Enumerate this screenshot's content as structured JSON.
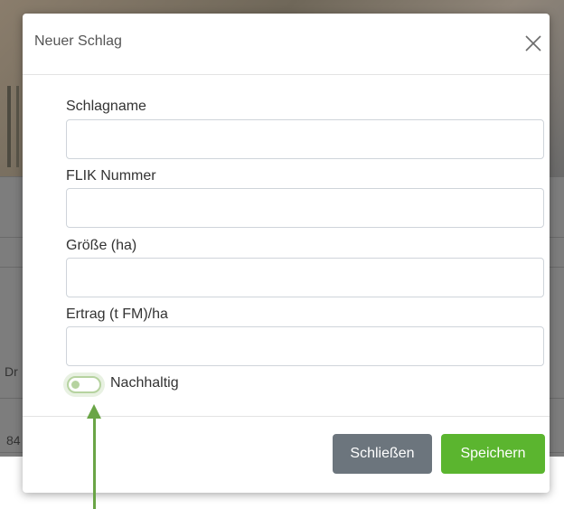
{
  "modal": {
    "title": "Neuer Schlag",
    "fields": [
      {
        "label": "Schlagname",
        "value": "",
        "placeholder": ""
      },
      {
        "label": "FLIK Nummer",
        "value": "",
        "placeholder": ""
      },
      {
        "label": "Größe (ha)",
        "value": "",
        "placeholder": ""
      },
      {
        "label": "Ertrag (t FM)/ha",
        "value": "",
        "placeholder": ""
      }
    ],
    "toggle": {
      "label": "Nachhaltig",
      "checked": false
    },
    "buttons": {
      "close_label": "Schließen",
      "save_label": "Speichern"
    }
  },
  "background": {
    "cell_partial_1": "Dr",
    "cell_partial_2": "84"
  },
  "colors": {
    "save": "#5bb52f",
    "close": "#6c757d",
    "toggle_accent": "#b6d3a0",
    "annotation_arrow": "#6aa546"
  },
  "icons": {
    "close": "close-icon"
  }
}
